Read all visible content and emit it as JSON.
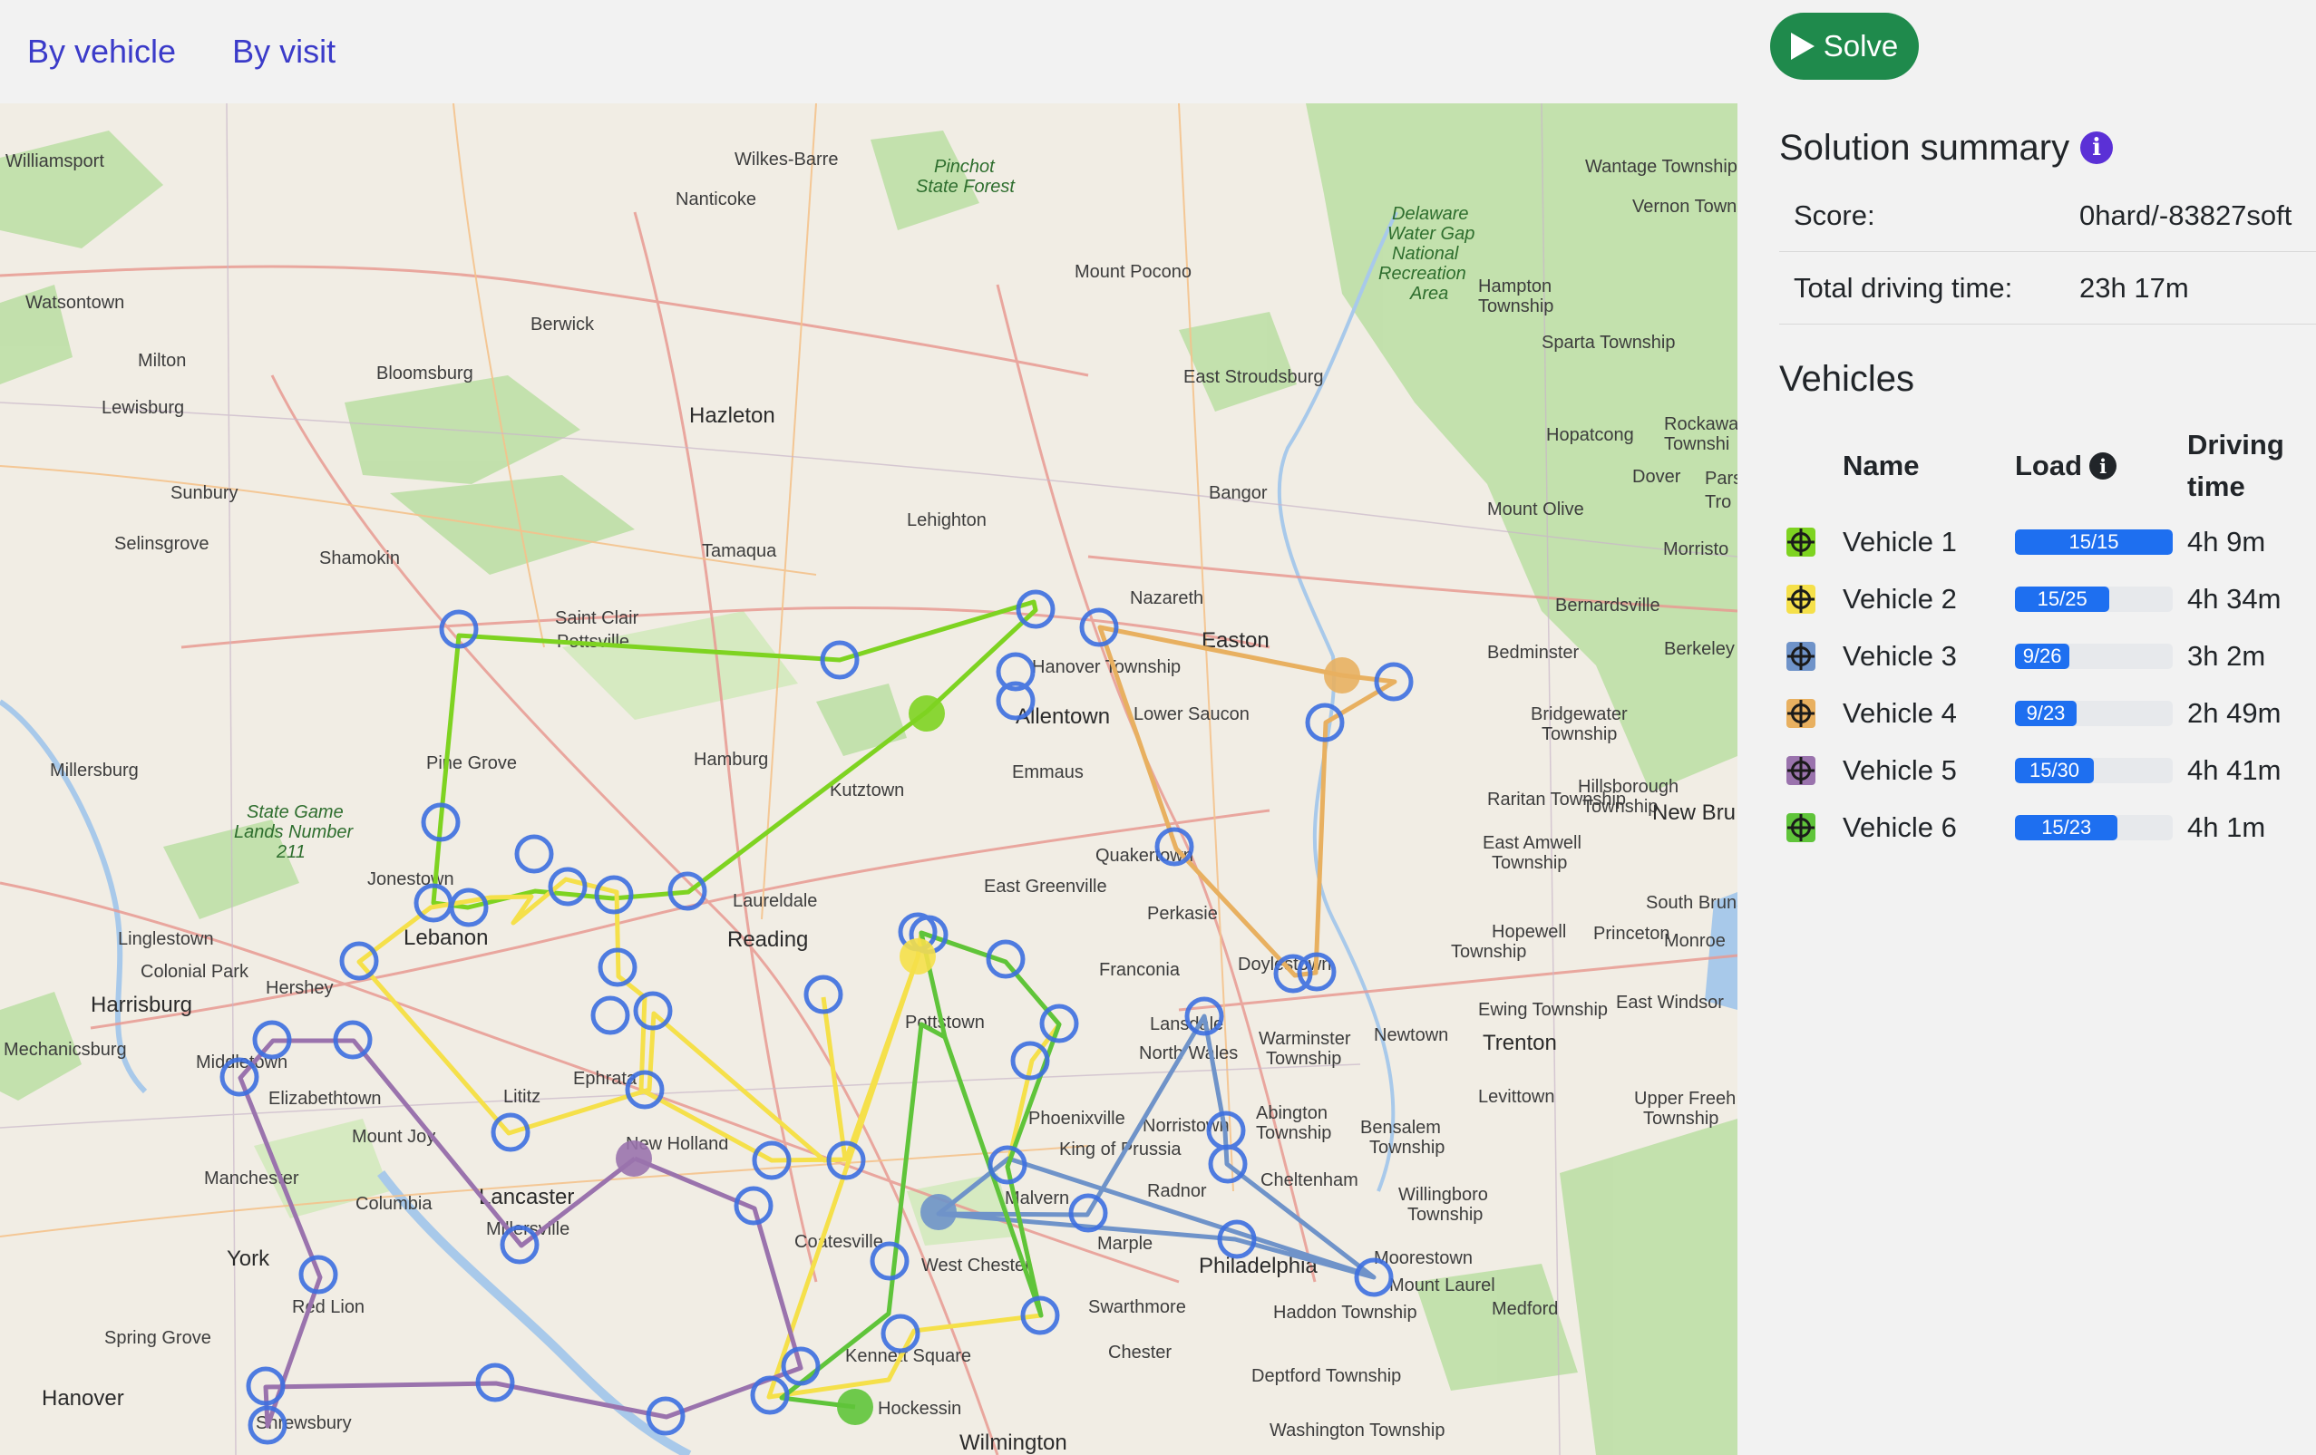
{
  "tabs": [
    {
      "label": "By vehicle"
    },
    {
      "label": "By visit"
    }
  ],
  "solve_button": {
    "label": "Solve",
    "icon": "play-icon"
  },
  "summary": {
    "title": "Solution summary",
    "info_icon": "info-icon",
    "score_label": "Score:",
    "score_value": "0hard/-83827soft",
    "driving_label": "Total driving time:",
    "driving_value": "23h 17m"
  },
  "vehicles": {
    "title": "Vehicles",
    "columns": {
      "name": "Name",
      "load": "Load",
      "driving_time": "Driving time"
    },
    "rows": [
      {
        "name": "Vehicle 1",
        "load": "15/15",
        "load_fraction": 1.0,
        "time": "4h 9m",
        "color": "#7ed321"
      },
      {
        "name": "Vehicle 2",
        "load": "15/25",
        "load_fraction": 0.6,
        "time": "4h 34m",
        "color": "#f5e04a"
      },
      {
        "name": "Vehicle 3",
        "load": "9/26",
        "load_fraction": 0.346,
        "time": "3h 2m",
        "color": "#6f93c9"
      },
      {
        "name": "Vehicle 4",
        "load": "9/23",
        "load_fraction": 0.391,
        "time": "2h 49m",
        "color": "#e8b060"
      },
      {
        "name": "Vehicle 5",
        "load": "15/30",
        "load_fraction": 0.5,
        "time": "4h 41m",
        "color": "#9a73ad"
      },
      {
        "name": "Vehicle 6",
        "load": "15/23",
        "load_fraction": 0.652,
        "time": "4h 1m",
        "color": "#5fc43a"
      }
    ]
  },
  "map": {
    "place_labels": [
      "Williamsport",
      "Wilkes-Barre",
      "Nanticoke",
      "Pinchot State Forest",
      "Mount Pocono",
      "Wantage Township",
      "Vernon Town",
      "Delaware Water Gap National Recreation Area",
      "Hampton Township",
      "Watsontown",
      "Berwick",
      "Sparta Township",
      "Milton",
      "Bloomsburg",
      "Hazleton",
      "East Stroudsburg",
      "Lewisburg",
      "Hopatcong",
      "Rockaway Township",
      "Sunbury",
      "Bangor",
      "Dover",
      "Mount Olive",
      "Selinsgrove",
      "Shamokin",
      "Tamaqua",
      "Lehighton",
      "Nazareth",
      "Morristow",
      "Saint Clair",
      "Pottsville",
      "Easton",
      "Bernardsville",
      "Hanover Township",
      "Bedminster",
      "Berkeley",
      "Allentown",
      "Lower Saucon",
      "Bridgewater Township",
      "Millersburg",
      "Pine Grove",
      "Hamburg",
      "Emmaus",
      "Raritan Township",
      "Hillsborough Township",
      "New Bru",
      "Kutztown",
      "State Game Lands Number 211",
      "East Amwell Township",
      "Quakertown",
      "Jonestown",
      "East Greenville",
      "Laureldale",
      "Perkasie",
      "South Brunswic",
      "Linglestown",
      "Lebanon",
      "Reading",
      "Hopewell Township",
      "Princeton",
      "Monroe",
      "Franconia",
      "Colonial Park",
      "Hershey",
      "Harrisburg",
      "Doylestown",
      "Ewing Township",
      "East Windsor",
      "Pottstown",
      "Lansdale",
      "Warminster Township",
      "Newtown",
      "Trenton",
      "Mechanicsburg",
      "Middletown",
      "North Wales",
      "Elizabethtown",
      "Ephrata",
      "Phoenixville",
      "Abington Township",
      "Bensalem Township",
      "Levittown",
      "Upper Freeh Township",
      "Lititz",
      "Norristown",
      "Mount Joy",
      "King of Prussia",
      "New Holland",
      "Manchester",
      "Cheltenham",
      "Lancaster",
      "Radnor",
      "Willingboro Township",
      "Columbia",
      "Malvern",
      "Millersville",
      "Coatesville",
      "Marple",
      "York",
      "West Chester",
      "Philadelphia",
      "Moorestown",
      "Mount Laurel",
      "Red Lion",
      "Swarthmore",
      "Haddon Township",
      "Medford",
      "Spring Grove",
      "Kennett Square",
      "Chester",
      "Deptford Township",
      "Hanover",
      "Hockessin",
      "Shrewsbury",
      "Washington Township",
      "Wilmington"
    ]
  }
}
